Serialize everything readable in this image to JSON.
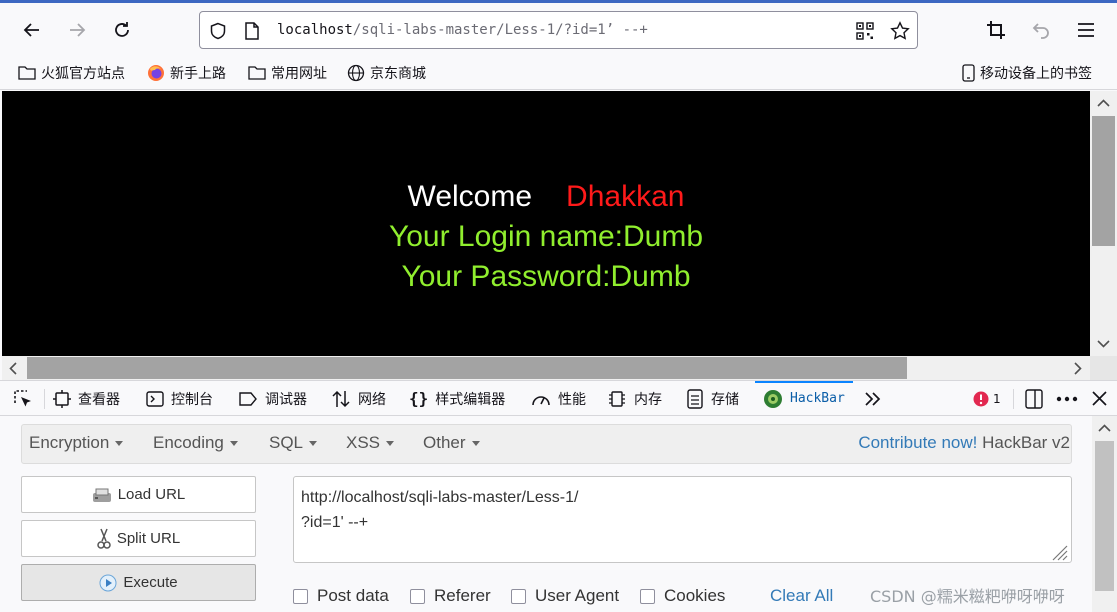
{
  "browser": {
    "url_host": "localhost",
    "url_path": "/sqli-labs-master/Less-1/?id=1’ --+",
    "accent_color": "#3d68c2"
  },
  "bookmarks": {
    "items": [
      {
        "label": "火狐官方站点",
        "icon": "folder-icon"
      },
      {
        "label": "新手上路",
        "icon": "firefox-icon"
      },
      {
        "label": "常用网址",
        "icon": "folder-icon"
      },
      {
        "label": "京东商城",
        "icon": "globe-icon"
      }
    ],
    "mobile": "移动设备上的书签"
  },
  "page": {
    "welcome": "Welcome",
    "name": "Dhakkan",
    "login_line": "Your Login name:Dumb",
    "password_line": "Your Password:Dumb",
    "colors": {
      "white": "#ffffff",
      "red": "#ff0000",
      "green": "#90ee2e",
      "bg": "#000000"
    }
  },
  "devtools": {
    "tabs": [
      {
        "label": "查看器",
        "icon": "inspector-icon"
      },
      {
        "label": "控制台",
        "icon": "console-icon"
      },
      {
        "label": "调试器",
        "icon": "debugger-icon"
      },
      {
        "label": "网络",
        "icon": "network-icon"
      },
      {
        "label": "样式编辑器",
        "icon": "braces-icon"
      },
      {
        "label": "性能",
        "icon": "performance-icon"
      },
      {
        "label": "内存",
        "icon": "memory-icon"
      },
      {
        "label": "存储",
        "icon": "storage-icon"
      },
      {
        "label": "HackBar",
        "icon": "hackbar-icon",
        "active": true
      }
    ],
    "error_count": "1"
  },
  "hackbar": {
    "menus": [
      "Encryption",
      "Encoding",
      "SQL",
      "XSS",
      "Other"
    ],
    "contribute": "Contribute now!",
    "version": "HackBar v2",
    "buttons": {
      "load": "Load URL",
      "split": "Split URL",
      "execute": "Execute"
    },
    "url_value": "http://localhost/sqli-labs-master/Less-1/\n?id=1' --+",
    "checkboxes": [
      "Post data",
      "Referer",
      "User Agent",
      "Cookies"
    ],
    "clear_all": "Clear All"
  },
  "watermark": "CSDN @糯米糍粑咿呀咿呀"
}
